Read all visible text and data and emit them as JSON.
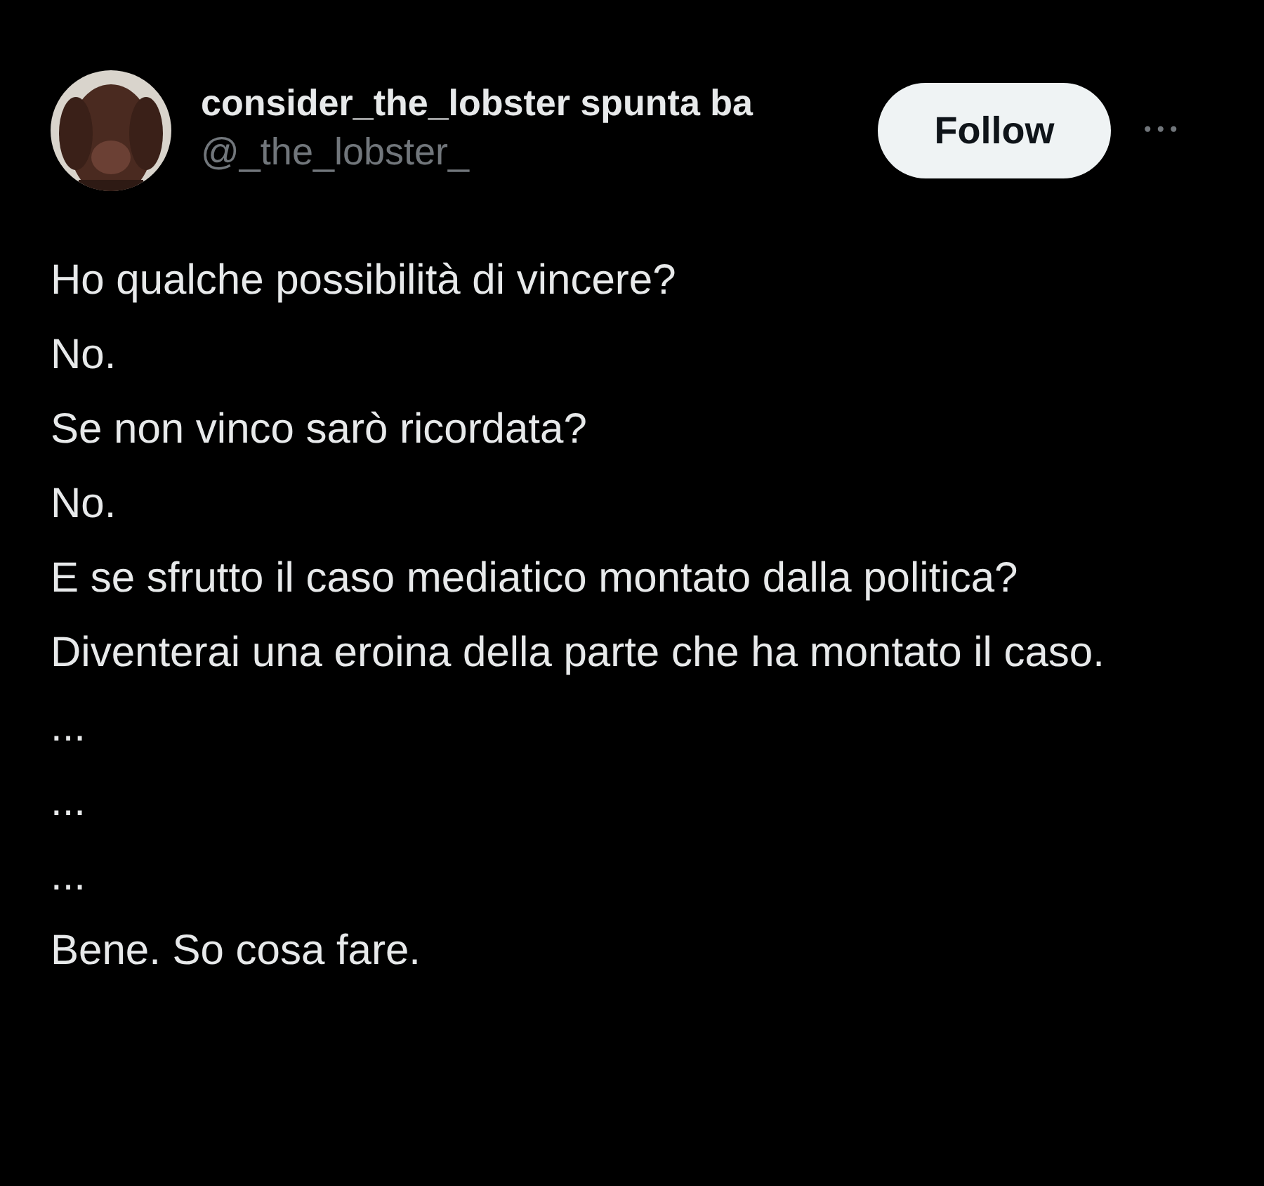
{
  "post": {
    "author": {
      "display_name": "consider_the_lobster spunta ba",
      "handle": "@_the_lobster_"
    },
    "follow_button": "Follow",
    "more_button": "•••",
    "lines": [
      "Ho qualche possibilità di vincere?",
      "No.",
      "Se non vinco sarò ricordata?",
      "No.",
      "E se sfrutto il caso mediatico montato dalla politica?",
      "Diventerai una eroina della parte che ha montato il caso.",
      "...",
      "...",
      "...",
      "Bene. So cosa fare."
    ]
  }
}
